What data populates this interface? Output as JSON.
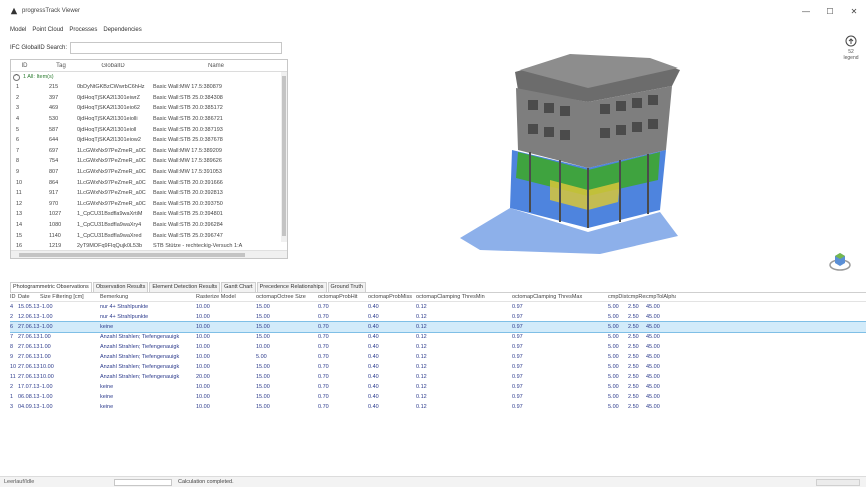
{
  "window": {
    "title": "progressTrack Viewer",
    "controls": [
      "—",
      "☐",
      "✕"
    ]
  },
  "menu": [
    "Model",
    "Point Cloud",
    "Processes",
    "Dependencies"
  ],
  "search": {
    "label": "IFC GlobalID Search:",
    "value": ""
  },
  "ifc_table": {
    "columns": [
      "ID",
      "Tag",
      "GlobalID",
      "Name"
    ],
    "group": {
      "toggle": "^",
      "label": "1 All: Item(s)"
    },
    "rows": [
      [
        "1",
        "215",
        "0bDyNtGKBzCWwrbC6hHz",
        "Basic Wall:MW 17.5:380879"
      ],
      [
        "2",
        "397",
        "0jdHoqTjSKA2l1301eiwrZ",
        "Basic Wall:STB 25.0:384308"
      ],
      [
        "3",
        "469",
        "0jdHoqTjSKA2l1301eio62",
        "Basic Wall:STB 20.0:385172"
      ],
      [
        "4",
        "530",
        "0jdHoqTjSKA2l1301eiolli",
        "Basic Wall:STB 20.0:386721"
      ],
      [
        "5",
        "587",
        "0jdHoqTjSKA2l1301eioll",
        "Basic Wall:STB 20.0:387193"
      ],
      [
        "6",
        "644",
        "0jdHoqTjSKA2l1301eiow2",
        "Basic Wall:STB 25.0:387678"
      ],
      [
        "7",
        "697",
        "1LcGWxNx97PeZmeR_a0C",
        "Basic Wall:MW 17.5:389209"
      ],
      [
        "8",
        "754",
        "1LcGWxNx97PeZmeR_a0C",
        "Basic Wall:MW 17.5:389626"
      ],
      [
        "9",
        "807",
        "1LcGWxNx97PeZmeR_a0C",
        "Basic Wall:MW 17.5:391053"
      ],
      [
        "10",
        "864",
        "1LcGWxNx97PeZmeR_a0C",
        "Basic Wall:STB 20.0:391666"
      ],
      [
        "11",
        "917",
        "1LcGWxNx97PeZmeR_a0C",
        "Basic Wall:STB 20.0:392813"
      ],
      [
        "12",
        "970",
        "1LcGWxNx97PeZmeR_a0C",
        "Basic Wall:STB 20.0:393750"
      ],
      [
        "13",
        "1027",
        "1_CpCU31Bsdfla9waXrtiM",
        "Basic Wall:STB 25.0:394801"
      ],
      [
        "14",
        "1080",
        "1_CpCU31BsdfIa9waXry4",
        "Basic Wall:STB 20.0:396284"
      ],
      [
        "15",
        "1140",
        "1_CpCU31BsdfIa9waXred",
        "Basic Wall:STB 25.0:396747"
      ],
      [
        "16",
        "1219",
        "2yT9MOFq9FIqQujk0L53b",
        "STB Stütze - rechteckig-Versuch 1:A"
      ]
    ]
  },
  "view3d": {
    "legend": {
      "value": "52",
      "label": "legend"
    },
    "colors": {
      "gray": "#8a8a8a",
      "dark": "#5a5a5a",
      "blue": "#2f6fd8",
      "green": "#3ea62e",
      "yellow": "#d8c63a"
    }
  },
  "tabs": [
    {
      "label": "Photogrammetric Observations",
      "active": true
    },
    {
      "label": "Observation Results",
      "active": false
    },
    {
      "label": "Element Detection Results",
      "active": false
    },
    {
      "label": "Gantt Chart",
      "active": false
    },
    {
      "label": "Precedence Relationships",
      "active": false
    },
    {
      "label": "Ground Truth",
      "active": false
    }
  ],
  "observations": {
    "columns": [
      "ID",
      "Date",
      "Size Filtering [cm]",
      "Bemerkung",
      "Rasterize Model",
      "octomapOctree Size",
      "octomapProbHit",
      "octomapProbMiss",
      "octomapClamping ThresMin",
      "octomapClamping ThresMax",
      "cmpDist",
      "cmpRes",
      "cmpTolAlpha"
    ],
    "rows": [
      {
        "selected": false,
        "cells": [
          "4",
          "15.05.13",
          "-1.00",
          "nur 4+ Strahlpunkte",
          "10.00",
          "15.00",
          "0.70",
          "0.40",
          "0.12",
          "0.97",
          "5.00",
          "2.50",
          "45.00"
        ]
      },
      {
        "selected": false,
        "cells": [
          "2",
          "12.06.13",
          "-1.00",
          "nur 4+ Strahlpunkte",
          "10.00",
          "15.00",
          "0.70",
          "0.40",
          "0.12",
          "0.97",
          "5.00",
          "2.50",
          "45.00"
        ]
      },
      {
        "selected": true,
        "cells": [
          "6",
          "27.06.13",
          "-1.00",
          "keine",
          "10.00",
          "15.00",
          "0.70",
          "0.40",
          "0.12",
          "0.97",
          "5.00",
          "2.50",
          "45.00"
        ]
      },
      {
        "selected": false,
        "cells": [
          "7",
          "27.06.13",
          "1.00",
          "Anzahl Strahlen; Tiefengenauigk",
          "10.00",
          "15.00",
          "0.70",
          "0.40",
          "0.12",
          "0.97",
          "5.00",
          "2.50",
          "45.00"
        ]
      },
      {
        "selected": false,
        "cells": [
          "8",
          "27.06.13",
          "1.00",
          "Anzahl Strahlen; Tiefengenauigk",
          "10.00",
          "10.00",
          "0.70",
          "0.40",
          "0.12",
          "0.97",
          "5.00",
          "2.50",
          "45.00"
        ]
      },
      {
        "selected": false,
        "cells": [
          "9",
          "27.06.13",
          "1.00",
          "Anzahl Strahlen; Tiefengenauigk",
          "10.00",
          "5.00",
          "0.70",
          "0.40",
          "0.12",
          "0.97",
          "5.00",
          "2.50",
          "45.00"
        ]
      },
      {
        "selected": false,
        "cells": [
          "10",
          "27.06.13",
          "10.00",
          "Anzahl Strahlen; Tiefengenauigk",
          "10.00",
          "15.00",
          "0.70",
          "0.40",
          "0.12",
          "0.97",
          "5.00",
          "2.50",
          "45.00"
        ]
      },
      {
        "selected": false,
        "cells": [
          "11",
          "27.06.13",
          "10.00",
          "Anzahl Strahlen; Tiefengenauigk",
          "20.00",
          "15.00",
          "0.70",
          "0.40",
          "0.12",
          "0.97",
          "5.00",
          "2.50",
          "45.00"
        ]
      },
      {
        "selected": false,
        "cells": [
          "2",
          "17.07.13",
          "-1.00",
          "keine",
          "10.00",
          "15.00",
          "0.70",
          "0.40",
          "0.12",
          "0.97",
          "5.00",
          "2.50",
          "45.00"
        ]
      },
      {
        "selected": false,
        "cells": [
          "1",
          "06.08.13",
          "-1.00",
          "keine",
          "10.00",
          "15.00",
          "0.70",
          "0.40",
          "0.12",
          "0.97",
          "5.00",
          "2.50",
          "45.00"
        ]
      },
      {
        "selected": false,
        "cells": [
          "3",
          "04.09.13",
          "-1.00",
          "keine",
          "10.00",
          "15.00",
          "0.70",
          "0.40",
          "0.12",
          "0.97",
          "5.00",
          "2.50",
          "45.00"
        ]
      }
    ]
  },
  "status": {
    "left": "Leerlauf/Idle",
    "message": "Calculation completed."
  }
}
